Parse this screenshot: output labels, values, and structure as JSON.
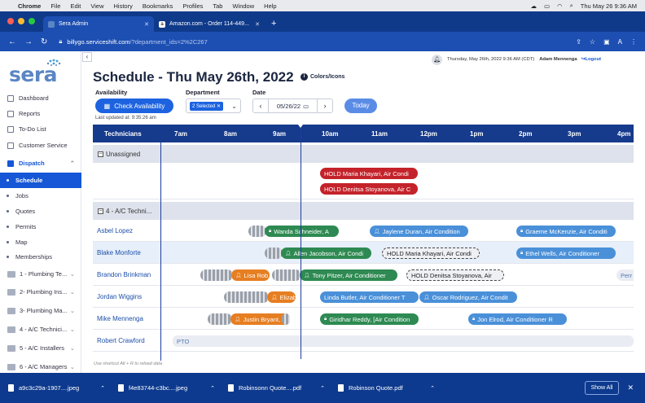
{
  "menubar": {
    "app": "Chrome",
    "items": [
      "File",
      "Edit",
      "View",
      "History",
      "Bookmarks",
      "Profiles",
      "Tab",
      "Window",
      "Help"
    ],
    "clock": "Thu May 26  9:36 AM"
  },
  "browser": {
    "tabs": [
      {
        "label": "Sera Admin",
        "active": true
      },
      {
        "label": "Amazon.com - Order 114-449...",
        "active": false
      }
    ],
    "url_host": "billygo.serviceshift.com",
    "url_path": "/?department_ids=2%2C267"
  },
  "header": {
    "datetime": "Thursday, May 26th, 2022 9:36 AM (CDT)",
    "user": "Adam Mennenga",
    "logout": "Logout"
  },
  "sidebar": {
    "logo": "sera",
    "items": [
      {
        "label": "Dashboard",
        "type": "top"
      },
      {
        "label": "Reports",
        "type": "top"
      },
      {
        "label": "To-Do List",
        "type": "top"
      },
      {
        "label": "Customer Service",
        "type": "top"
      },
      {
        "label": "Dispatch",
        "type": "head"
      },
      {
        "label": "Schedule",
        "type": "sub",
        "active": true
      },
      {
        "label": "Jobs",
        "type": "sub"
      },
      {
        "label": "Quotes",
        "type": "sub"
      },
      {
        "label": "Permits",
        "type": "sub"
      },
      {
        "label": "Map",
        "type": "sub"
      },
      {
        "label": "Memberships",
        "type": "sub"
      },
      {
        "label": "1 - Plumbing Te...",
        "type": "dept"
      },
      {
        "label": "2- Plumbing Ins...",
        "type": "dept"
      },
      {
        "label": "3- Plumbing Ma...",
        "type": "dept"
      },
      {
        "label": "4 - A/C Technici...",
        "type": "dept"
      },
      {
        "label": "5 - A/C Installers",
        "type": "dept"
      },
      {
        "label": "6 - A/C Managers",
        "type": "dept"
      }
    ]
  },
  "page": {
    "title": "Schedule - Thu May 26th, 2022",
    "colors_icons": "Colors/Icons",
    "availability_label": "Availability",
    "check_availability": "Check Availability",
    "last_updated": "Last updated at: 9:35:26 am",
    "department_label": "Department",
    "department_chip": "2 Selected",
    "date_label": "Date",
    "date_value": "05/26/22",
    "today": "Today",
    "shortcut": "Use shortcut Alt + R to reload data"
  },
  "grid": {
    "tech_header": "Technicians",
    "hours": [
      "7am",
      "8am",
      "9am",
      "10am",
      "11am",
      "12pm",
      "1pm",
      "2pm",
      "3pm",
      "4pm"
    ],
    "group_unassigned": "Unassigned",
    "group_ac": "4 - A/C Techni...",
    "technicians": [
      "Asbel Lopez",
      "Blake Monforte",
      "Brandon Brinkman",
      "Jordan Wiggins",
      "Mike Mennenga",
      "Robert Crawford"
    ],
    "unassigned_events": [
      "HOLD Maria Khayari, Air Condi",
      "HOLD Denitsa Stoyanova, Air C"
    ],
    "events": {
      "asbel": [
        "Wanda Schneider, A",
        "Jaylene Duran, Air Condition",
        "Graeme McKenzie, Air Conditi"
      ],
      "blake": [
        "Allen Jacobson, Air Condi",
        "HOLD Maria Khayari, Air Condi",
        "Ethel Wells, Air Conditioner"
      ],
      "brandon": [
        "Lisa Rob",
        "Tony Pitzer, Air Conditioner",
        "HOLD Denitsa Stoyanova, Air",
        "Perr"
      ],
      "jordan": [
        "Elizabe",
        "Linda Butler, Air Conditioner T",
        "Oscar Rodriguez, Air Condit"
      ],
      "mike": [
        "Justin Bryant, A",
        "Giridhar Reddy, [Air Condition",
        "Jon Elrod, Air Conditioner R"
      ],
      "robert": [
        "PTO"
      ]
    }
  },
  "downloads": {
    "files": [
      "a9c3c29a-1907....jpeg",
      "f4e83744-c3bc....jpeg",
      "Robinsonn Quote....pdf",
      "Robinson Quote.pdf"
    ],
    "show_all": "Show All"
  }
}
